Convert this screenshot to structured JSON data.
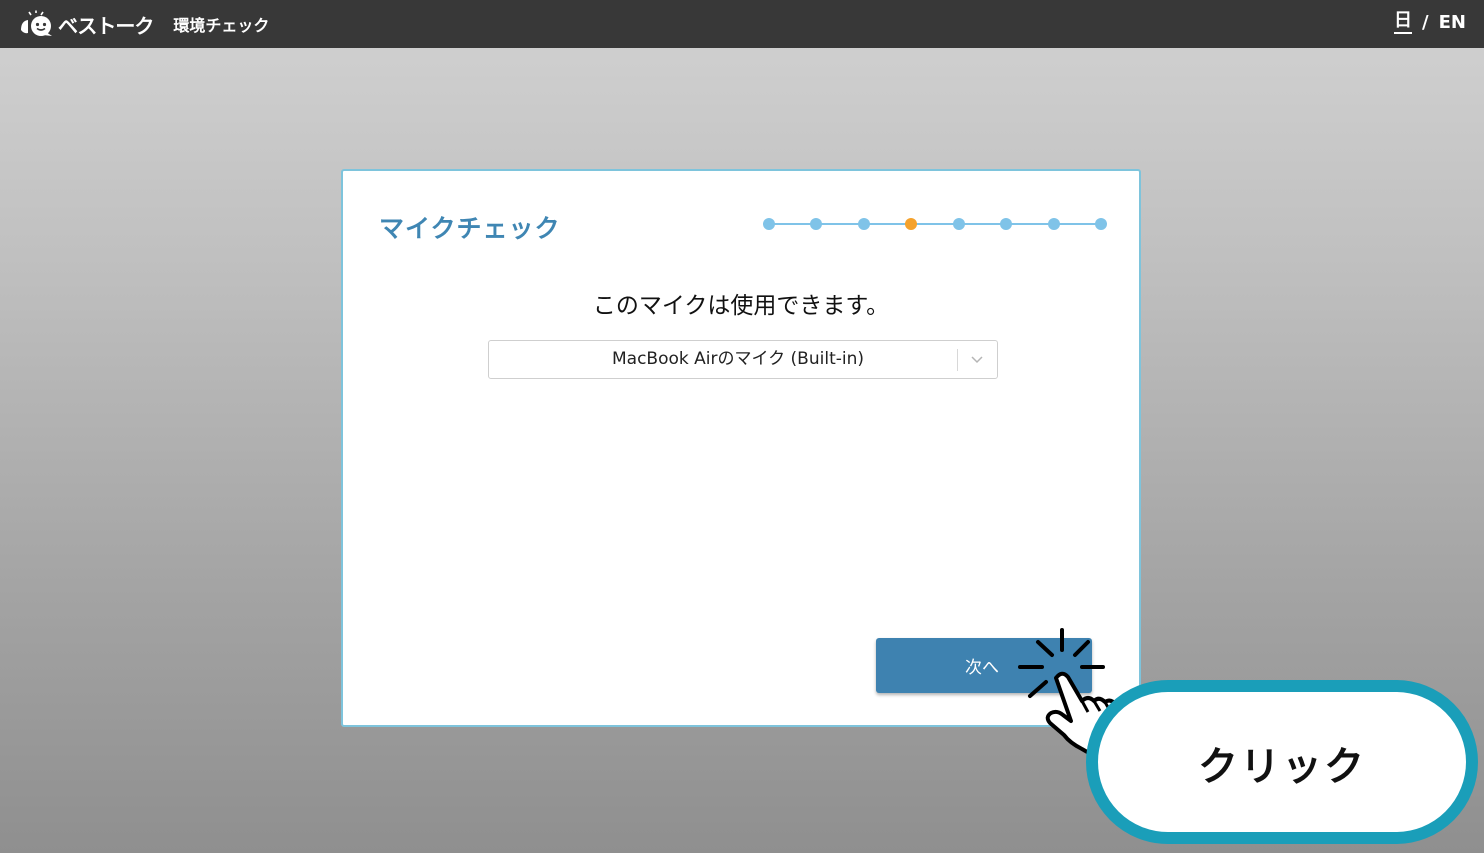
{
  "header": {
    "brand": "ベストーク",
    "page_title": "環境チェック",
    "lang_ja": "日",
    "lang_sep": "/",
    "lang_en": "EN"
  },
  "card": {
    "title": "マイクチェック",
    "steps_total": 8,
    "current_step": 4,
    "message": "このマイクは使用できます。",
    "mic_select": {
      "selected": "MacBook Airのマイク (Built-in)"
    },
    "next_label": "次へ"
  },
  "annotation": {
    "callout_text": "クリック"
  },
  "colors": {
    "header_bg": "#383838",
    "accent_blue": "#3f86b3",
    "step_dot": "#7fc3e8",
    "step_active": "#f5a22c",
    "button_bg": "#3e82b0",
    "callout_border": "#1a9eb9"
  },
  "icons": {
    "logo": "bestalk-logo-icon",
    "select_arrow": "chevron-down-icon",
    "pointer": "pointing-hand-icon"
  }
}
